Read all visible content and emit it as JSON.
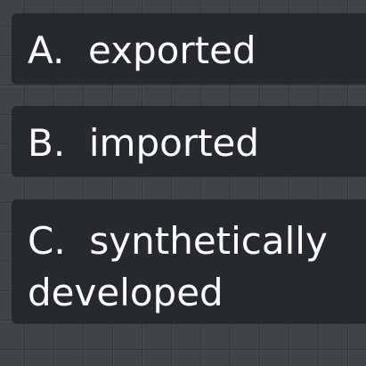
{
  "options": [
    {
      "letter": "A.",
      "text": "exported"
    },
    {
      "letter": "B.",
      "text": "imported"
    },
    {
      "letter": "C.",
      "text": "synthetically developed"
    }
  ],
  "colors": {
    "background": "#3f4449",
    "option_background": "#26292e",
    "option_text": "#ffffff"
  }
}
